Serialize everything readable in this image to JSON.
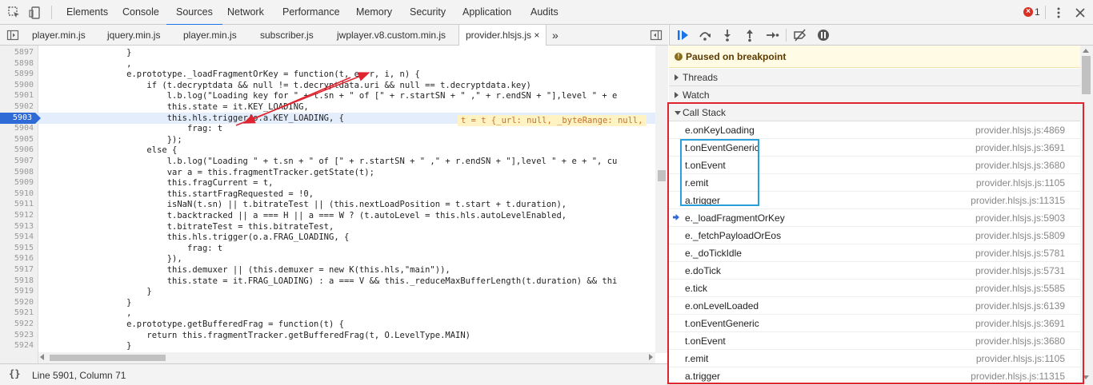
{
  "toolbar": {
    "tabs": [
      {
        "label": "Elements"
      },
      {
        "label": "Console"
      },
      {
        "label": "Sources"
      },
      {
        "label": "Network"
      },
      {
        "label": "Performance"
      },
      {
        "label": "Memory"
      },
      {
        "label": "Security"
      },
      {
        "label": "Application"
      },
      {
        "label": "Audits"
      }
    ],
    "active_tab": "Sources",
    "error_count": "1"
  },
  "file_tabs": [
    {
      "label": "player.min.js"
    },
    {
      "label": "jquery.min.js"
    },
    {
      "label": "player.min.js"
    },
    {
      "label": "subscriber.js"
    },
    {
      "label": "jwplayer.v8.custom.min.js"
    },
    {
      "label": "provider.hlsjs.js ×"
    }
  ],
  "file_tabs_more": "»",
  "editor": {
    "current_line": "5903",
    "inline_value": "t = t {_url: null, _byteRange: null,",
    "lines": [
      {
        "n": "5897",
        "code": "                }"
      },
      {
        "n": "5898",
        "code": "                ,"
      },
      {
        "n": "5899",
        "code": "                e.prototype._loadFragmentOrKey = function(t, e, r, i, n) {"
      },
      {
        "n": "5900",
        "code": "                    if (t.decryptdata && null != t.decryptdata.uri && null == t.decryptdata.key)"
      },
      {
        "n": "5901",
        "code": "                        l.b.log(\"Loading key for \" + t.sn + \" of [\" + r.startSN + \" ,\" + r.endSN + \"],level \" + e"
      },
      {
        "n": "5902",
        "code": "                        this.state = it.KEY_LOADING,"
      },
      {
        "n": "5903",
        "code": "                        this.hls.trigger(o.a.KEY_LOADING, {"
      },
      {
        "n": "5904",
        "code": "                            frag: t"
      },
      {
        "n": "5905",
        "code": "                        });"
      },
      {
        "n": "5906",
        "code": "                    else {"
      },
      {
        "n": "5907",
        "code": "                        l.b.log(\"Loading \" + t.sn + \" of [\" + r.startSN + \" ,\" + r.endSN + \"],level \" + e + \", cu"
      },
      {
        "n": "5908",
        "code": "                        var a = this.fragmentTracker.getState(t);"
      },
      {
        "n": "5909",
        "code": "                        this.fragCurrent = t,"
      },
      {
        "n": "5910",
        "code": "                        this.startFragRequested = !0,"
      },
      {
        "n": "5911",
        "code": "                        isNaN(t.sn) || t.bitrateTest || (this.nextLoadPosition = t.start + t.duration),"
      },
      {
        "n": "5912",
        "code": "                        t.backtracked || a === H || a === W ? (t.autoLevel = this.hls.autoLevelEnabled,"
      },
      {
        "n": "5913",
        "code": "                        t.bitrateTest = this.bitrateTest,"
      },
      {
        "n": "5914",
        "code": "                        this.hls.trigger(o.a.FRAG_LOADING, {"
      },
      {
        "n": "5915",
        "code": "                            frag: t"
      },
      {
        "n": "5916",
        "code": "                        }),"
      },
      {
        "n": "5917",
        "code": "                        this.demuxer || (this.demuxer = new K(this.hls,\"main\")),"
      },
      {
        "n": "5918",
        "code": "                        this.state = it.FRAG_LOADING) : a === V && this._reduceMaxBufferLength(t.duration) && thi"
      },
      {
        "n": "5919",
        "code": "                    }"
      },
      {
        "n": "5920",
        "code": "                }"
      },
      {
        "n": "5921",
        "code": "                ,"
      },
      {
        "n": "5922",
        "code": "                e.prototype.getBufferedFrag = function(t) {"
      },
      {
        "n": "5923",
        "code": "                    return this.fragmentTracker.getBufferedFrag(t, O.LevelType.MAIN)"
      },
      {
        "n": "5924",
        "code": "                }"
      }
    ]
  },
  "status": {
    "format_icon": "{}",
    "position": "Line 5901, Column 71"
  },
  "debugger": {
    "paused_message": "Paused on breakpoint",
    "sections": {
      "threads": "Threads",
      "watch": "Watch",
      "call_stack": "Call Stack"
    },
    "call_stack": [
      {
        "name": "e.onKeyLoading",
        "location": "provider.hlsjs.js:4869"
      },
      {
        "name": "t.onEventGeneric",
        "location": "provider.hlsjs.js:3691"
      },
      {
        "name": "t.onEvent",
        "location": "provider.hlsjs.js:3680"
      },
      {
        "name": "r.emit",
        "location": "provider.hlsjs.js:1105"
      },
      {
        "name": "a.trigger",
        "location": "provider.hlsjs.js:11315"
      },
      {
        "name": "e._loadFragmentOrKey",
        "location": "provider.hlsjs.js:5903"
      },
      {
        "name": "e._fetchPayloadOrEos",
        "location": "provider.hlsjs.js:5809"
      },
      {
        "name": "e._doTickIdle",
        "location": "provider.hlsjs.js:5781"
      },
      {
        "name": "e.doTick",
        "location": "provider.hlsjs.js:5731"
      },
      {
        "name": "e.tick",
        "location": "provider.hlsjs.js:5585"
      },
      {
        "name": "e.onLevelLoaded",
        "location": "provider.hlsjs.js:6139"
      },
      {
        "name": "t.onEventGeneric",
        "location": "provider.hlsjs.js:3691"
      },
      {
        "name": "t.onEvent",
        "location": "provider.hlsjs.js:3680"
      },
      {
        "name": "r.emit",
        "location": "provider.hlsjs.js:1105"
      },
      {
        "name": "a.trigger",
        "location": "provider.hlsjs.js:11315"
      }
    ]
  },
  "colors": {
    "accent": "#1a73e8",
    "breakpoint_line": "#2f6bd6",
    "annotation_red": "#e0242f",
    "annotation_blue": "#2a9fd8",
    "paused_banner": "#fffbe5"
  }
}
